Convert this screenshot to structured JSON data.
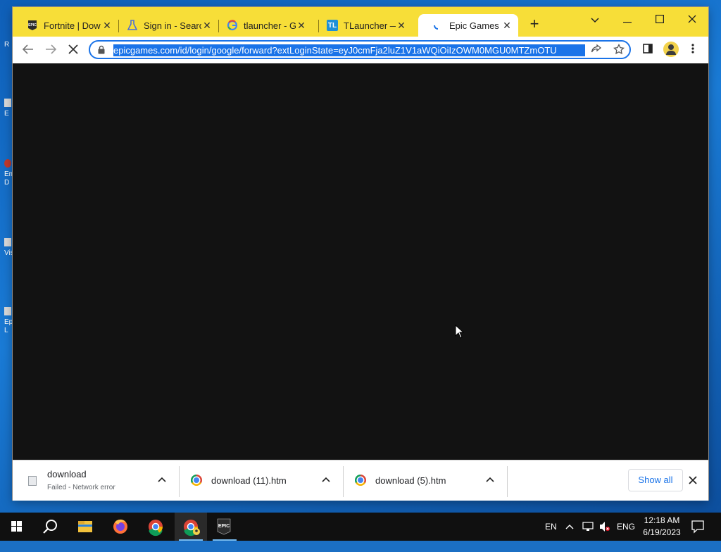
{
  "desktop": {
    "icon_fragments": [
      "R",
      "E",
      "Em",
      "D",
      "Vis",
      "Ep",
      "L"
    ]
  },
  "browser": {
    "tabs": [
      {
        "title": "Fortnite | Dow",
        "favicon": "epic-logo-icon"
      },
      {
        "title": "Sign in - Searc",
        "favicon": "flask-icon"
      },
      {
        "title": "tlauncher - Go",
        "favicon": "google-icon"
      },
      {
        "title": "TLauncher — I",
        "favicon": "tl-icon"
      },
      {
        "title": "Epic Games",
        "favicon": "loading-spinner-icon",
        "active": true
      }
    ],
    "new_tab_label": "+",
    "window_controls": {
      "collapse": "⌄",
      "minimize": "—",
      "maximize": "☐",
      "close": "✕"
    },
    "address_bar": {
      "url": "epicgames.com/id/login/google/forward?extLoginState=eyJ0cmFja2luZ1V1aWQiOiIzOWM0MGU0MTZmOTU",
      "selected": true
    },
    "nav": {
      "back": "←",
      "forward": "→",
      "stop": "✕"
    },
    "accent_color": "#f7de38",
    "page_background": "#121212"
  },
  "downloads": {
    "items": [
      {
        "name": "download",
        "status": "Failed - Network error",
        "icon": "file-icon"
      },
      {
        "name": "download (11).htm",
        "status": "",
        "icon": "chrome-icon"
      },
      {
        "name": "download (5).htm",
        "status": "",
        "icon": "chrome-icon"
      }
    ],
    "show_all_label": "Show all",
    "chevron": "⌃",
    "close": "✕"
  },
  "taskbar": {
    "apps": [
      "start-icon",
      "search-icon",
      "file-explorer-icon",
      "firefox-icon",
      "chrome-icon",
      "chrome-profile-icon",
      "epic-games-icon"
    ],
    "tray": {
      "lang": "EN",
      "input_lang": "ENG"
    },
    "clock": {
      "time": "12:18 AM",
      "date": "6/19/2023"
    }
  }
}
